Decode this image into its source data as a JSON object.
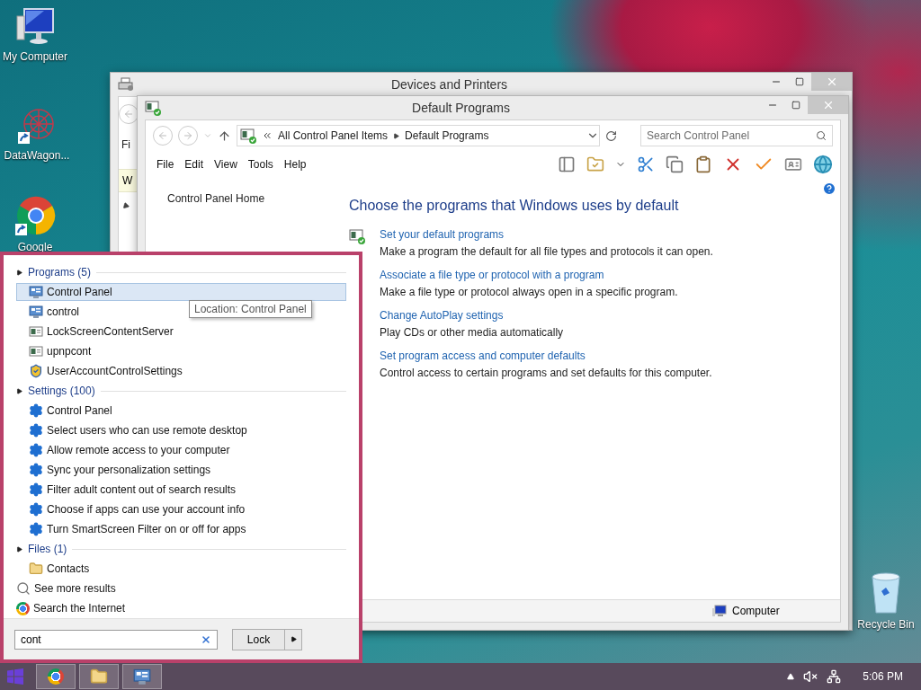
{
  "desktop_icons": [
    {
      "label": "My Computer",
      "kind": "computer"
    },
    {
      "label": "DataWagon...",
      "kind": "app"
    },
    {
      "label": "Google",
      "kind": "chrome"
    },
    {
      "label": "Recycle Bin",
      "kind": "bin"
    }
  ],
  "back_window": {
    "title": "Devices and Printers",
    "menu_fragment": "Fi",
    "row_fragment": "W"
  },
  "window": {
    "title": "Default Programs",
    "breadcrumb": [
      "All Control Panel Items",
      "Default Programs"
    ],
    "search": {
      "placeholder": "Search Control Panel"
    },
    "menu": [
      "File",
      "Edit",
      "View",
      "Tools",
      "Help"
    ],
    "sidebar_link": "Control Panel Home",
    "heading": "Choose the programs that Windows uses by default",
    "tasks": [
      {
        "link": "Set your default programs",
        "description": "Make a program the default for all file types and protocols it can open.",
        "has_icon": true
      },
      {
        "link": "Associate a file type or protocol with a program",
        "description": "Make a file type or protocol always open in a specific program.",
        "has_icon": false
      },
      {
        "link": "Change AutoPlay settings",
        "description": "Play CDs or other media automatically",
        "has_icon": false
      },
      {
        "link": "Set program access and computer defaults",
        "description": "Control access to certain programs and set defaults for this computer.",
        "has_icon": false
      }
    ],
    "status_bar": "Computer"
  },
  "start_menu": {
    "groups": [
      {
        "title": "Programs (5)",
        "items": [
          {
            "label": "Control Panel",
            "kind": "control-panel",
            "selected": true
          },
          {
            "label": "control",
            "kind": "control-panel",
            "selected": false
          },
          {
            "label": "LockScreenContentServer",
            "kind": "app",
            "selected": false
          },
          {
            "label": "upnpcont",
            "kind": "app",
            "selected": false
          },
          {
            "label": "UserAccountControlSettings",
            "kind": "shield",
            "selected": false
          }
        ]
      },
      {
        "title": "Settings (100)",
        "items": [
          {
            "label": "Control Panel",
            "kind": "gear",
            "selected": false
          },
          {
            "label": "Select users who can use remote desktop",
            "kind": "gear",
            "selected": false
          },
          {
            "label": "Allow remote access to your computer",
            "kind": "gear",
            "selected": false
          },
          {
            "label": "Sync your personalization settings",
            "kind": "gear",
            "selected": false
          },
          {
            "label": "Filter adult content out of search results",
            "kind": "gear",
            "selected": false
          },
          {
            "label": "Choose if apps can use your account info",
            "kind": "gear",
            "selected": false
          },
          {
            "label": "Turn SmartScreen Filter on or off for apps",
            "kind": "gear",
            "selected": false
          }
        ]
      },
      {
        "title": "Files (1)",
        "items": [
          {
            "label": "Contacts",
            "kind": "folder",
            "selected": false
          }
        ]
      }
    ],
    "links": [
      {
        "label": "See more results",
        "kind": "search"
      },
      {
        "label": "Search the Internet",
        "kind": "chrome"
      }
    ],
    "tooltip": "Location: Control Panel",
    "search": {
      "value": "cont"
    },
    "power_button": "Lock"
  },
  "taskbar": {
    "apps": [
      {
        "kind": "chrome"
      },
      {
        "kind": "folder"
      },
      {
        "kind": "control-panel"
      }
    ],
    "clock": "5:06 PM"
  }
}
